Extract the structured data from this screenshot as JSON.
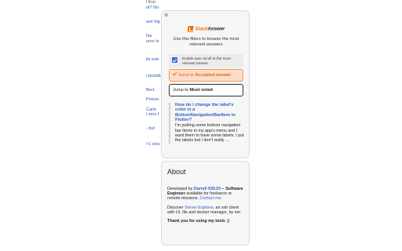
{
  "background_page": {
    "lines": [
      {
        "text": "l that",
        "color": "gray"
      },
      {
        "text": "rit? No",
        "color": "link"
      },
      {
        "text": "ave hig",
        "color": "link"
      },
      {
        "text": "Na",
        "color": "link"
      },
      {
        "text": "ame tir",
        "color": "gray"
      },
      {
        "text": "ile solv",
        "color": "link"
      },
      {
        "text": "i possib",
        "color": "link"
      },
      {
        "text": "ffect",
        "color": "link"
      },
      {
        "text": "Poisso",
        "color": "link"
      },
      {
        "text": "Carlo",
        "color": "link"
      },
      {
        "text": "i zero f",
        "color": "link"
      },
      {
        "text": "- but",
        "color": "link"
      },
      {
        "text": "+1 wou",
        "color": "link"
      }
    ]
  },
  "popup": {
    "settings_icon": "gear-icon",
    "brand": {
      "part1": "Stack",
      "part2": "Answer",
      "icon": "stackanswer-logo-icon",
      "accent": "#f2740c"
    },
    "intro": "Use this filters to browse the most relevant answers",
    "autoscroll": {
      "label": "Enable auto scroll to the most relevant answer",
      "checked": true
    },
    "jump_accepted": {
      "prefix": "Jump to ",
      "target": "Accepted answer"
    },
    "jump_voted": {
      "prefix": "Jump to ",
      "target": "Most voted"
    },
    "question": {
      "title": "How do i change the label's color in a BottomNavigationBarItem in Flutter?",
      "body": "I'm putting some bottom navigation bar items in my app's menu and I want them to have some labels. I put the labels but I don't really ..."
    }
  },
  "about": {
    "title": "About",
    "dev_prefix": "Developed by ",
    "dev_name": "Darrell KIDJO",
    "dev_dash": " – ",
    "dev_role": "Software Engineer",
    "dev_suffix": " available for freelance or remote missions.",
    "contact": "Contact me.",
    "discover_prefix": "Discover ",
    "discover_link": "Server Explorer",
    "discover_suffix": ", an ssh client with UI, file and docker manager, by me.",
    "thanks": "Thank you for using my tools ;)"
  }
}
